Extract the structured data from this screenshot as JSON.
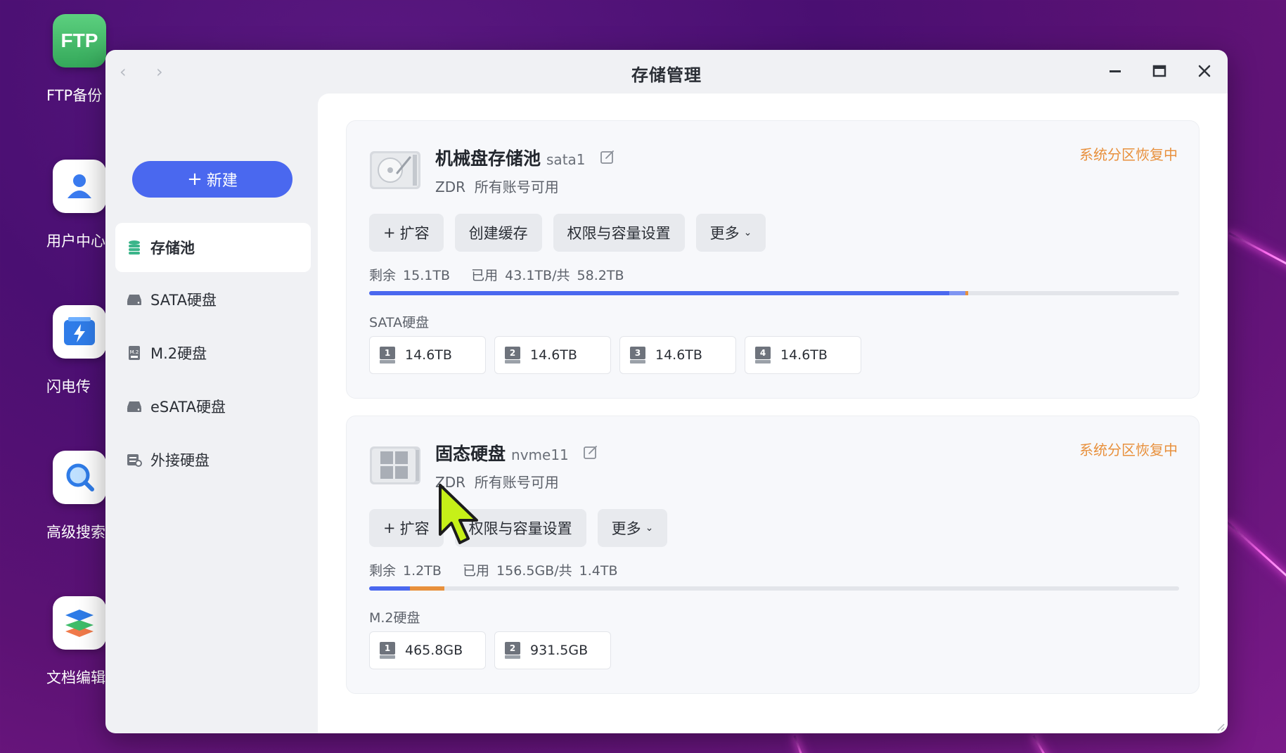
{
  "desktop": {
    "icons": [
      {
        "label": "FTP备份",
        "icon": "ftp-icon",
        "color": "#3fbd6a"
      },
      {
        "label": "用户中心",
        "icon": "user-icon",
        "color": "#ffffff"
      },
      {
        "label": "闪电传",
        "icon": "lightning-transfer-icon",
        "color": "#ffffff"
      },
      {
        "label": "高级搜索",
        "icon": "search-icon",
        "color": "#ffffff"
      },
      {
        "label": "文档编辑",
        "icon": "layers-icon",
        "color": "#ffffff"
      }
    ],
    "ftp_tile_text": "FTP"
  },
  "window": {
    "title": "存储管理"
  },
  "sidebar": {
    "new_button": "新建",
    "items": [
      {
        "label": "存储池",
        "icon": "database-icon",
        "active": true
      },
      {
        "label": "SATA硬盘",
        "icon": "hdd-icon"
      },
      {
        "label": "M.2硬盘",
        "icon": "m2-icon"
      },
      {
        "label": "eSATA硬盘",
        "icon": "hdd-icon"
      },
      {
        "label": "外接硬盘",
        "icon": "external-drive-icon"
      }
    ]
  },
  "pools": [
    {
      "name": "机械盘存储池",
      "device": "sata1",
      "subtitle": "ZDR  所有账号可用",
      "status": "系统分区恢复中",
      "buttons": [
        "扩容",
        "创建缓存",
        "权限与容量设置",
        "更多"
      ],
      "usage_text": "剩余 15.1TB   已用 43.1TB/共 58.2TB",
      "used_fraction": 0.716,
      "cache_fraction": 0.024,
      "group_label": "SATA硬盘",
      "disks": [
        {
          "slot": "1",
          "size": "14.6TB"
        },
        {
          "slot": "2",
          "size": "14.6TB"
        },
        {
          "slot": "3",
          "size": "14.6TB"
        },
        {
          "slot": "4",
          "size": "14.6TB"
        }
      ]
    },
    {
      "name": "固态硬盘",
      "device": "nvme11",
      "subtitle": "ZDR  所有账号可用",
      "status": "系统分区恢复中",
      "buttons": [
        "扩容",
        "权限与容量设置",
        "更多"
      ],
      "usage_text": "剩余 1.2TB   已用 156.5GB/共 1.4TB",
      "used_fraction": 0.05,
      "cache_fraction": 0.043,
      "group_label": "M.2硬盘",
      "disks": [
        {
          "slot": "1",
          "size": "465.8GB"
        },
        {
          "slot": "2",
          "size": "931.5GB"
        }
      ]
    }
  ],
  "colors": {
    "accent": "#4a68ef",
    "status": "#e8903c",
    "cache": "#e8903c",
    "cache_alt": "#7f95f2",
    "cursor": "#c6f018"
  }
}
